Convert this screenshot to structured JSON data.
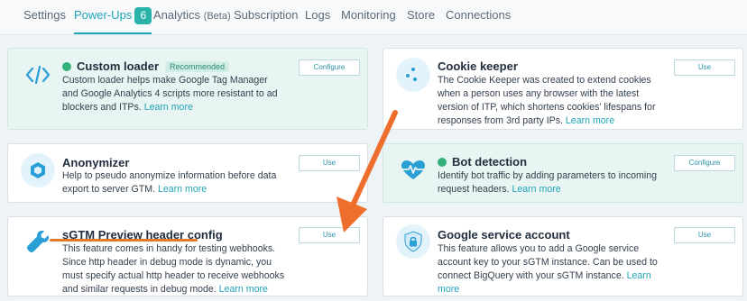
{
  "tabs": [
    {
      "label": "Settings"
    },
    {
      "label": "Power-Ups",
      "badge": "6"
    },
    {
      "label": "Analytics",
      "suffix": "(Beta)"
    },
    {
      "label": "Subscription"
    },
    {
      "label": "Logs"
    },
    {
      "label": "Monitoring"
    },
    {
      "label": "Store"
    },
    {
      "label": "Connections"
    }
  ],
  "active_tab": "Power-Ups",
  "colors": {
    "accent": "#22a3b7",
    "enabled_card": "#e8f5f2",
    "status_on": "#35b07a",
    "annotation": "#e07a2e"
  },
  "cards": [
    {
      "title": "Custom loader",
      "badge": "Recommended",
      "enabled": true,
      "description": "Custom loader helps make Google Tag Manager and Google Analytics 4 scripts more resistant to ad blockers and ITPs.",
      "link": "Learn more",
      "button": "Configure",
      "icon": "code-icon"
    },
    {
      "title": "Cookie keeper",
      "enabled": false,
      "description": "The Cookie Keeper was created to extend cookies when a person uses any browser with the latest version of ITP, which shortens cookies' lifespans for responses from 3rd party IPs.",
      "link": "Learn more",
      "button": "Use",
      "icon": "cookie-icon"
    },
    {
      "title": "Anonymizer",
      "enabled": false,
      "description": "Help to pseudo anonymize information before data export to server GTM.",
      "link": "Learn more",
      "button": "Use",
      "icon": "hexagon-icon"
    },
    {
      "title": "Bot detection",
      "enabled": true,
      "description": "Identify bot traffic by adding parameters to incoming request headers.",
      "link": "Learn more",
      "button": "Configure",
      "icon": "heartbeat-icon"
    },
    {
      "title": "sGTM Preview header config",
      "enabled": false,
      "description": "This feature comes in handy for testing webhooks. Since http header in debug mode is dynamic, you must specify actual http header to receive webhooks and similar requests in debug mode.",
      "link": "Learn more",
      "button": "Use",
      "icon": "wrench-icon"
    },
    {
      "title": "Google service account",
      "enabled": false,
      "description": "This feature allows you to add a Google service account key to your sGTM instance. Can be used to connect BigQuery with your sGTM instance.",
      "link": "Learn more",
      "button": "Use",
      "icon": "shield-lock-icon"
    }
  ]
}
